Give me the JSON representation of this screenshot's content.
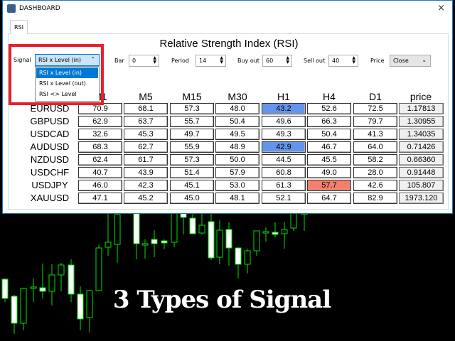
{
  "window": {
    "title": "DASHBOARD",
    "close": "×"
  },
  "tab": "RSI",
  "panel_title": "Relative Strength Index (RSI)",
  "controls": {
    "signal_label": "Signal",
    "signal_value": "RSI x Level (in)",
    "signal_options": [
      "RSI x Level (in)",
      "RSI x Level (out)",
      "RSI <> Level"
    ],
    "bar_label": "Bar",
    "bar_value": "0",
    "period_label": "Period",
    "period_value": "14",
    "buyout_label": "Buy out",
    "buyout_value": "60",
    "sellout_label": "Sell out",
    "sellout_value": "40",
    "price_label": "Price",
    "price_value": "Close"
  },
  "table": {
    "headers": [
      "M1",
      "M5",
      "M15",
      "M30",
      "H1",
      "H4",
      "D1",
      "price"
    ],
    "rows": [
      {
        "symbol": "EURUSD",
        "values": [
          "70.9",
          "68.1",
          "57.3",
          "48.0",
          "43.2",
          "52.6",
          "72.5",
          "1.17813"
        ]
      },
      {
        "symbol": "GBPUSD",
        "values": [
          "62.9",
          "63.7",
          "55.7",
          "50.4",
          "49.6",
          "66.3",
          "79.7",
          "1.30955"
        ]
      },
      {
        "symbol": "USDCAD",
        "values": [
          "32.6",
          "45.3",
          "49.7",
          "49.5",
          "49.3",
          "50.4",
          "41.3",
          "1.34035"
        ]
      },
      {
        "symbol": "AUDUSD",
        "values": [
          "68.3",
          "62.7",
          "55.9",
          "48.9",
          "42.9",
          "46.7",
          "64.0",
          "0.71426"
        ]
      },
      {
        "symbol": "NZDUSD",
        "values": [
          "62.4",
          "61.7",
          "57.3",
          "50.0",
          "44.5",
          "45.5",
          "58.2",
          "0.66360"
        ]
      },
      {
        "symbol": "USDCHF",
        "values": [
          "40.7",
          "43.9",
          "51.4",
          "57.9",
          "60.8",
          "49.0",
          "28.0",
          "0.91448"
        ]
      },
      {
        "symbol": "USDJPY",
        "values": [
          "46.0",
          "42.3",
          "45.1",
          "53.0",
          "61.3",
          "57.7",
          "42.6",
          "105.807"
        ]
      },
      {
        "symbol": "XAUUSD",
        "values": [
          "47.1",
          "45.2",
          "45.0",
          "48.1",
          "52.1",
          "64.7",
          "82.9",
          "1973.120"
        ]
      }
    ],
    "highlights": [
      {
        "row": 0,
        "col": 4,
        "color": "#6495ed"
      },
      {
        "row": 3,
        "col": 4,
        "color": "#6495ed"
      },
      {
        "row": 6,
        "col": 5,
        "color": "#f4806c"
      }
    ]
  },
  "caption": "3 Types of Signal",
  "colors": {
    "accent": "#0078d7",
    "highlight_red_box": "#e8202a",
    "candle_green": "#00e000"
  }
}
